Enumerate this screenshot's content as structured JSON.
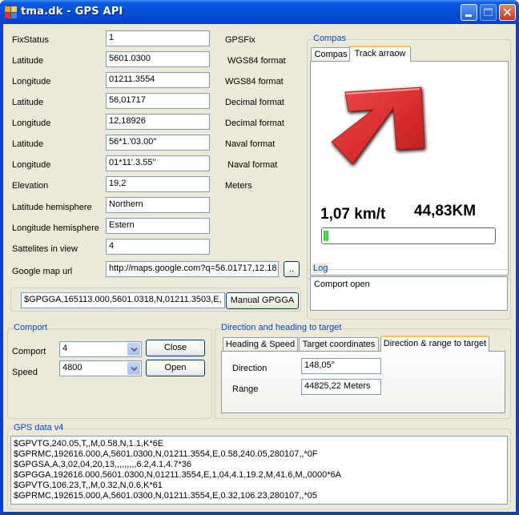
{
  "window": {
    "title": "tma.dk - GPS API",
    "icon": "app-icon",
    "controls": {
      "minimize": "minimize-icon",
      "maximize": "maximize-icon",
      "close": "close-icon"
    },
    "close_glyph": "✕"
  },
  "fields": [
    {
      "label": "FixStatus",
      "value": "1",
      "unit": "GPSFix"
    },
    {
      "label": "Latitude",
      "value": "5601.0300",
      "unit": "WGS84 format"
    },
    {
      "label": "Longitude",
      "value": "01211.3554",
      "unit": "WGS84 format"
    },
    {
      "label": "Latitude",
      "value": "56,01717",
      "unit": "Decimal format"
    },
    {
      "label": "Longitude",
      "value": "12,18926",
      "unit": "Decimal format"
    },
    {
      "label": "Latitude",
      "value": "56*1.'03.00''",
      "unit": "Naval format"
    },
    {
      "label": "Longitude",
      "value": "01*11'.3.55''",
      "unit": "Naval format"
    },
    {
      "label": "Elevation",
      "value": "19,2",
      "unit": "Meters"
    },
    {
      "label": "Latitude hemisphere",
      "value": "Northern",
      "unit": ""
    },
    {
      "label": "Longitude hemisphere",
      "value": "Estern",
      "unit": ""
    },
    {
      "label": "Sattelites in view",
      "value": "4",
      "unit": ""
    },
    {
      "label": "Google map url",
      "value": "http://maps.google.com?q=56.01717,12.18",
      "unit": ""
    }
  ],
  "browse_button": "..",
  "manual": {
    "input_value": "$GPGGA,165113.000,5601.0318,N,01211.3503,E,",
    "button_label": "Manual GPGGA"
  },
  "compas": {
    "group_title": "Compas",
    "tabs": [
      {
        "label": "Compas",
        "active": false
      },
      {
        "label": "Track arraow",
        "active": true
      }
    ],
    "arrow_icon": "track-arrow-icon",
    "arrow_color": "#d93030",
    "speed": "1,07 km/t",
    "distance": "44,83KM",
    "progress_percent": 3,
    "progress_color": "#31c631"
  },
  "log": {
    "group_title": "Log",
    "lines": [
      "Comport open"
    ]
  },
  "comport": {
    "group_title": "Comport",
    "port_label": "Comport",
    "port_value": "4",
    "speed_label": "Speed",
    "speed_value": "4800",
    "close_button": "Close",
    "open_button": "Open"
  },
  "direction": {
    "group_title": "Direction and heading to target",
    "tabs": [
      {
        "label": "Heading & Speed",
        "active": false
      },
      {
        "label": "Target coordinates",
        "active": false
      },
      {
        "label": "Direction & range to target",
        "active": true
      }
    ],
    "direction_label": "Direction",
    "direction_value": "148,05°",
    "range_label": "Range",
    "range_value": "44825,22 Meters"
  },
  "gps_data": {
    "group_title": "GPS data v4",
    "lines": [
      "$GPVTG,240.05,T,,M,0.58,N,1.1,K*6E",
      "$GPRMC,192616.000,A,5601.0300,N,01211.3554,E,0.58,240.05,280107,,*0F",
      "$GPGSA,A,3,02,04,20,13,,,,,,,,,6.2,4.1,4.7*36",
      "$GPGGA,192616.000,5601.0300,N,01211.3554,E,1,04,4.1,19.2,M,41.6,M,,0000*6A",
      "$GPVTG,106.23,T,,M,0.32,N,0.6,K*61",
      "$GPRMC,192615.000,A,5601.0300,N,01211.3554,E,0.32,106.23,280107,,*05"
    ]
  }
}
